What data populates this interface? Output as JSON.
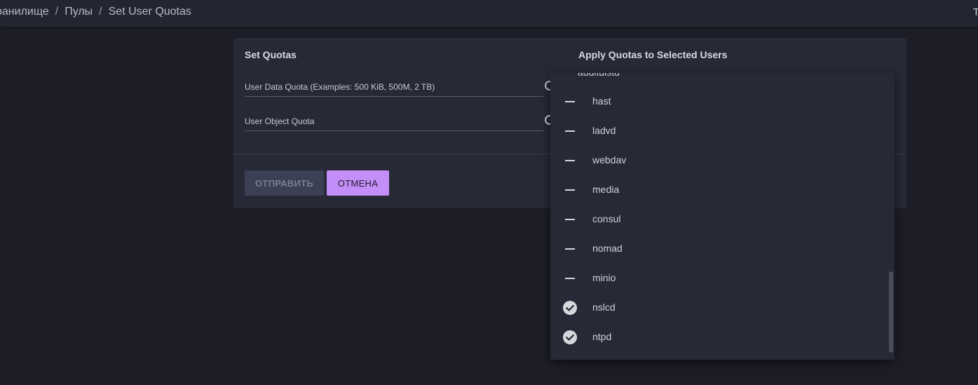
{
  "breadcrumb": {
    "items": [
      "ранилище",
      "Пулы",
      "Set User Quotas"
    ],
    "separator": "/"
  },
  "corner_glyph": "T",
  "card": {
    "left_title": "Set Quotas",
    "right_title": "Apply Quotas to Selected Users",
    "fields": {
      "data_quota_label": "User Data Quota (Examples: 500 KiB, 500M, 2 TB)",
      "object_quota_label": "User Object Quota"
    },
    "buttons": {
      "submit": "ОТПРАВИТЬ",
      "cancel": "ОТМЕНА"
    }
  },
  "dropdown": {
    "partial_top_item": "auditdistd",
    "options": [
      {
        "label": "hast",
        "selected": false
      },
      {
        "label": "ladvd",
        "selected": false
      },
      {
        "label": "webdav",
        "selected": false
      },
      {
        "label": "media",
        "selected": false
      },
      {
        "label": "consul",
        "selected": false
      },
      {
        "label": "nomad",
        "selected": false
      },
      {
        "label": "minio",
        "selected": false
      },
      {
        "label": "nslcd",
        "selected": true
      },
      {
        "label": "ntpd",
        "selected": true
      }
    ]
  },
  "colors": {
    "accent": "#c48ef8",
    "background": "#1c1d27",
    "card": "#272936"
  },
  "icons": {
    "help": "help-circle-icon",
    "unselected": "dash-icon",
    "selected": "check-circle-icon"
  }
}
